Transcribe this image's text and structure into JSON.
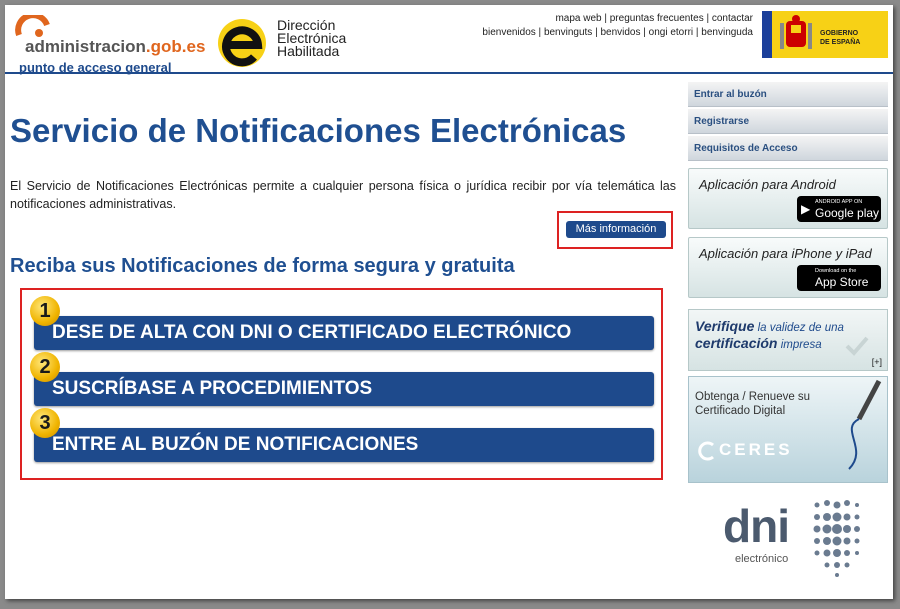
{
  "header": {
    "admin_logo_text": "administracion",
    "admin_logo_domain": ".gob.es",
    "admin_subtitle": "punto de acceso general",
    "deh_line1": "Dirección",
    "deh_line2": "Electrónica",
    "deh_line3": "Habilitada",
    "top_links_row1": [
      "mapa web",
      "preguntas frecuentes",
      "contactar"
    ],
    "top_links_row2": [
      "bienvenidos",
      "benvinguts",
      "benvidos",
      "ongi etorri",
      "benvinguda"
    ],
    "gob_line1": "GOBIERNO",
    "gob_line2": "DE ESPAÑA"
  },
  "main": {
    "title": "Servicio de Notificaciones Electrónicas",
    "intro": "El Servicio de Notificaciones Electrónicas permite a cualquier persona física o jurídica recibir por vía telemática las notificaciones administrativas.",
    "more_button": "Más información",
    "subtitle": "Reciba sus Notificaciones de forma segura y gratuita",
    "steps": [
      {
        "num": "1",
        "label": "DESE DE ALTA CON DNI O CERTIFICADO ELECTRÓNICO"
      },
      {
        "num": "2",
        "label": "SUSCRÍBASE A PROCEDIMIENTOS"
      },
      {
        "num": "3",
        "label": "ENTRE AL BUZÓN DE NOTIFICACIONES"
      }
    ]
  },
  "sidebar": {
    "links": [
      "Entrar al buzón",
      "Registrarse",
      "Requisitos de Acceso"
    ],
    "android_title": "Aplicación para Android",
    "android_badge_small": "ANDROID APP ON",
    "android_badge_big": "Google play",
    "iphone_title": "Aplicación para iPhone y iPad",
    "iphone_badge_small": "Download on the",
    "iphone_badge_big": "App Store",
    "verify_word1": "Verifique",
    "verify_rest1": "la validez de una",
    "verify_word2": "certificación",
    "verify_rest2": "impresa",
    "verify_plus": "[+]",
    "ceres_line1": "Obtenga / Renueve su",
    "ceres_line2": "Certificado Digital",
    "ceres_logo": "CERES"
  },
  "dni": {
    "big": "dni",
    "small": "electrónico"
  }
}
